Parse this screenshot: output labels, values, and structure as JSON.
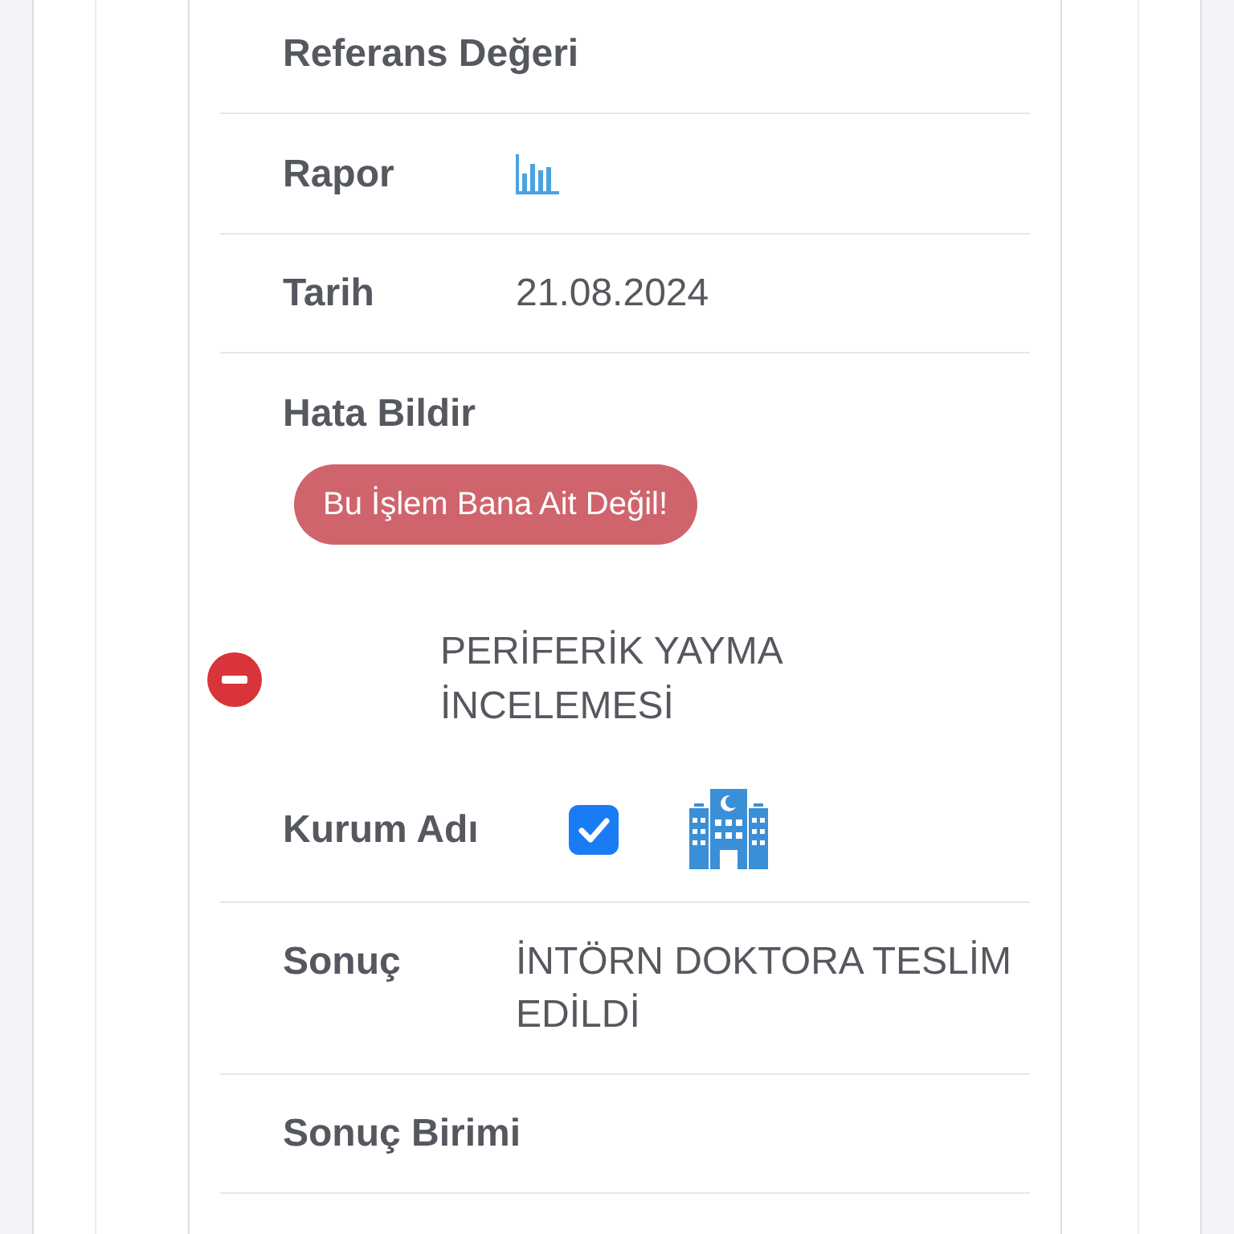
{
  "rows": [
    {
      "kind": "text",
      "label": "Referans Değeri"
    },
    {
      "kind": "chart",
      "label": "Rapor"
    },
    {
      "kind": "text",
      "label": "Tarih",
      "value": "21.08.2024"
    },
    {
      "kind": "report",
      "label": "Hata Bildir",
      "button": "Bu İşlem Bana Ait Değil!"
    }
  ],
  "test": {
    "expanded": true,
    "name": "PERİFERİK YAYMA İNCELEMESİ",
    "rows": [
      {
        "kind": "institution",
        "label": "Kurum Adı",
        "checked": true
      },
      {
        "kind": "text",
        "label": "Sonuç",
        "value": "İNTÖRN DOKTORA TESLİM EDİLDİ"
      },
      {
        "kind": "text",
        "label": "Sonuç Birimi"
      }
    ]
  }
}
